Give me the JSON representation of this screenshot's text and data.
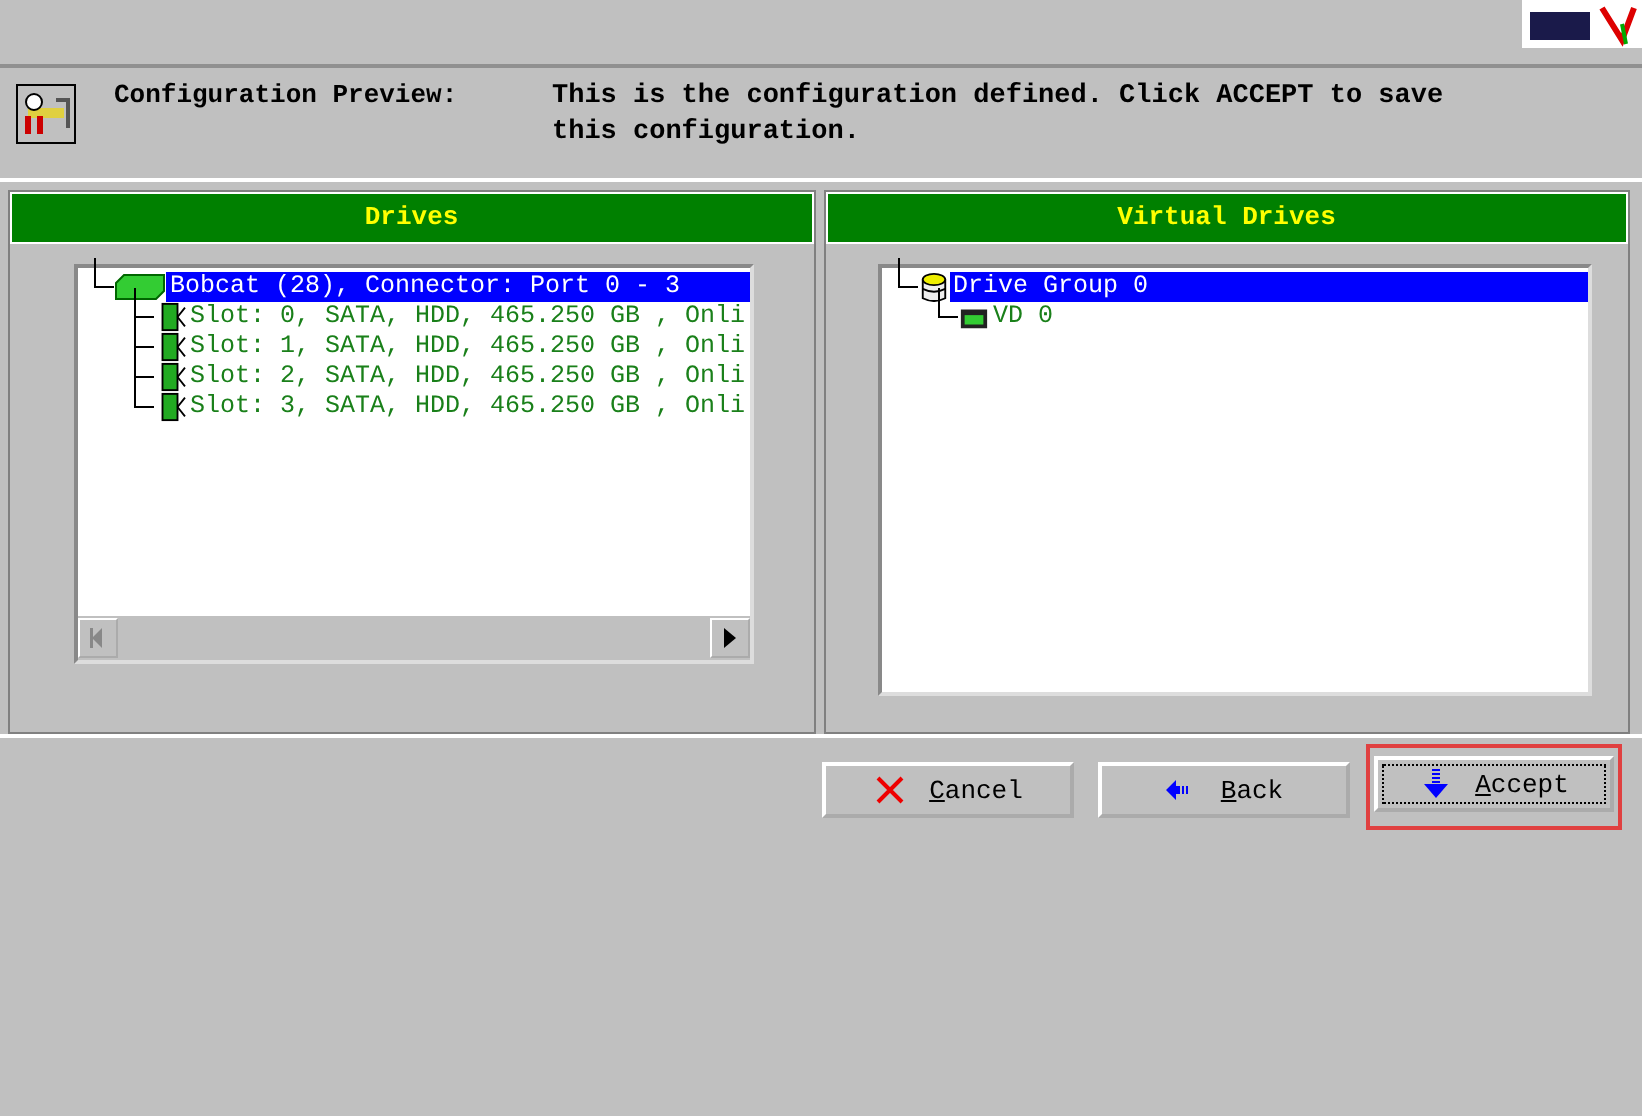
{
  "header": {
    "title": "Configuration Preview:",
    "description": "This is the configuration defined. Click ACCEPT to save this configuration."
  },
  "panels": [
    {
      "title": "Drives",
      "scrollbar": true,
      "tree": [
        {
          "kind": "enclosure",
          "label": "Bobcat (28), Connector: Port 0 - 3",
          "selected": true,
          "children": [
            {
              "kind": "drive",
              "label": "Slot: 0, SATA, HDD, 465.250 GB , Onli",
              "selected": false
            },
            {
              "kind": "drive",
              "label": "Slot: 1, SATA, HDD, 465.250 GB , Onli",
              "selected": false
            },
            {
              "kind": "drive",
              "label": "Slot: 2, SATA, HDD, 465.250 GB , Onli",
              "selected": false
            },
            {
              "kind": "drive",
              "label": "Slot: 3, SATA, HDD, 465.250 GB , Onli",
              "selected": false
            }
          ]
        }
      ]
    },
    {
      "title": "Virtual Drives",
      "scrollbar": false,
      "tree": [
        {
          "kind": "drive_group",
          "label": "Drive Group 0",
          "selected": true,
          "children": [
            {
              "kind": "virtual_drive",
              "label": "VD 0",
              "selected": false
            }
          ]
        }
      ]
    }
  ],
  "buttons": [
    {
      "kind": "cancel",
      "label": "Cancel",
      "focused": false,
      "highlighted": false
    },
    {
      "kind": "back",
      "label": "Back",
      "focused": false,
      "highlighted": false
    },
    {
      "kind": "accept",
      "label": "Accept",
      "focused": true,
      "highlighted": true
    }
  ]
}
